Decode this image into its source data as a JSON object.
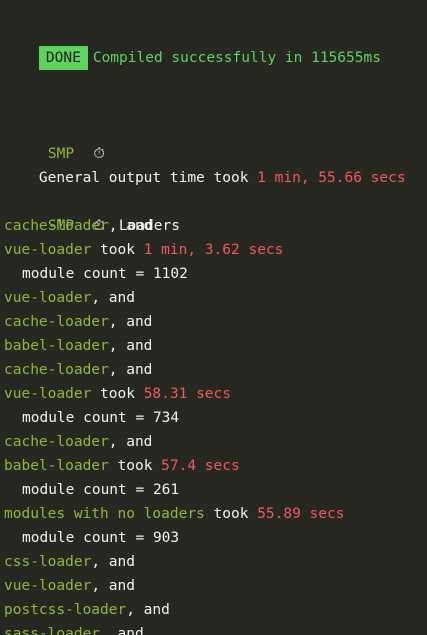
{
  "header": {
    "badge": "DONE",
    "message": "Compiled successfully in 115655ms"
  },
  "general": {
    "smp_tag": "SMP",
    "stopwatch_glyph": "⏱",
    "label": "General output time took",
    "time": "1 min, 55.66 secs"
  },
  "loaders": {
    "smp_tag": "SMP",
    "stopwatch_glyph": "⏱",
    "title": "Loaders",
    "lines": [
      {
        "kind": "chain",
        "name": "cache-loader",
        "suffix": ", and"
      },
      {
        "kind": "took",
        "name": "vue-loader",
        "took": "took",
        "time": "1 min, 3.62 secs"
      },
      {
        "kind": "count",
        "text": "module count = 1102"
      },
      {
        "kind": "chain",
        "name": "vue-loader",
        "suffix": ", and"
      },
      {
        "kind": "chain",
        "name": "cache-loader",
        "suffix": ", and"
      },
      {
        "kind": "chain",
        "name": "babel-loader",
        "suffix": ", and"
      },
      {
        "kind": "chain",
        "name": "cache-loader",
        "suffix": ", and"
      },
      {
        "kind": "took",
        "name": "vue-loader",
        "took": "took",
        "time": "58.31 secs"
      },
      {
        "kind": "count",
        "text": "module count = 734"
      },
      {
        "kind": "chain",
        "name": "cache-loader",
        "suffix": ", and"
      },
      {
        "kind": "took",
        "name": "babel-loader",
        "took": "took",
        "time": "57.4 secs"
      },
      {
        "kind": "count",
        "text": "module count = 261"
      },
      {
        "kind": "took",
        "name": "modules with no loaders",
        "took": "took",
        "time": "55.89 secs"
      },
      {
        "kind": "count",
        "text": "module count = 903"
      },
      {
        "kind": "chain",
        "name": "css-loader",
        "suffix": ", and"
      },
      {
        "kind": "chain",
        "name": "vue-loader",
        "suffix": ", and"
      },
      {
        "kind": "chain",
        "name": "postcss-loader",
        "suffix": ", and"
      },
      {
        "kind": "chain",
        "name": "sass-loader",
        "suffix": ", and"
      }
    ]
  },
  "colors": {
    "background": "#272822",
    "done_green": "#5fd35f",
    "loader_green": "#8fb83a",
    "time_red": "#ef5a5a",
    "text_white": "#f2f2ee"
  }
}
